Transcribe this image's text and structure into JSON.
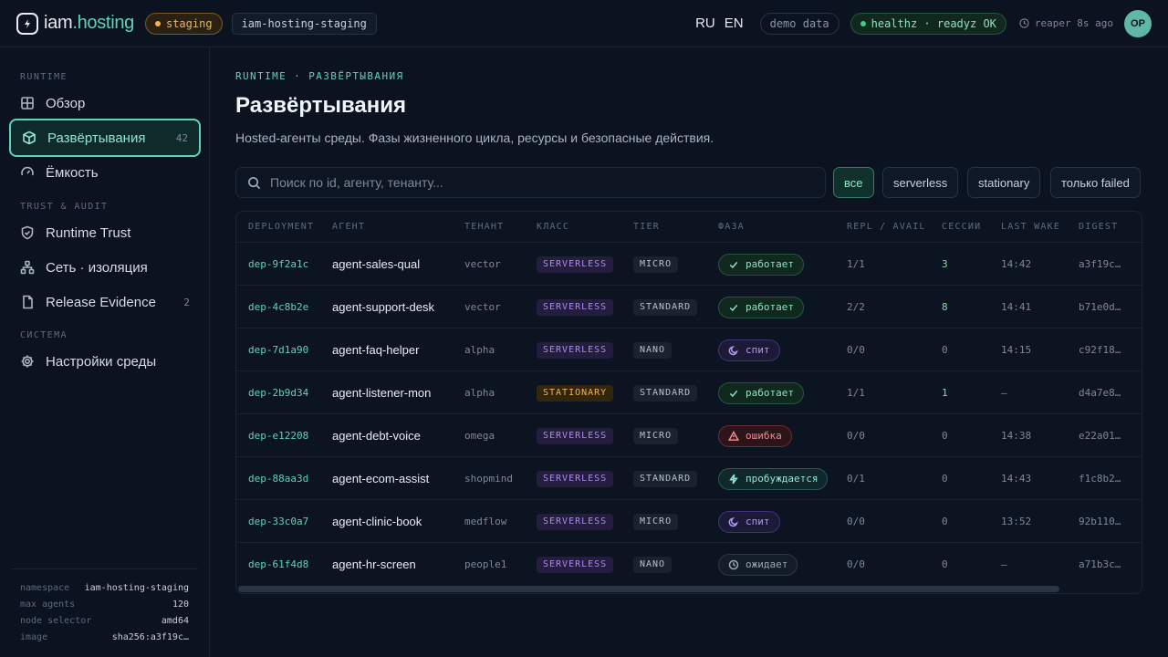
{
  "app": {
    "logo_left": "iam",
    "logo_right": ".hosting",
    "env_badge": "staging",
    "namespace_badge": "iam-hosting-staging",
    "lang_ru": "RU",
    "lang_en": "EN",
    "demo_badge": "demo data",
    "health_badge": "healthz · readyz OK",
    "reaper_text": "reaper 8s ago",
    "avatar_initials": "OP"
  },
  "sidebar": {
    "sections": [
      "RUNTIME",
      "TRUST & AUDIT",
      "СИСТЕМА"
    ],
    "items": [
      {
        "label": "Обзор",
        "icon": "grid-icon"
      },
      {
        "label": "Развёртывания",
        "icon": "cube-icon",
        "count": "42",
        "active": true
      },
      {
        "label": "Ёмкость",
        "icon": "gauge-icon"
      },
      {
        "label": "Runtime Trust",
        "icon": "shield-icon"
      },
      {
        "label": "Сеть · изоляция",
        "icon": "network-icon"
      },
      {
        "label": "Release Evidence",
        "icon": "file-icon",
        "count": "2"
      },
      {
        "label": "Настройки среды",
        "icon": "gear-icon"
      }
    ],
    "meta": [
      {
        "k": "namespace",
        "v": "iam-hosting-staging"
      },
      {
        "k": "max agents",
        "v": "120"
      },
      {
        "k": "node selector",
        "v": "amd64"
      },
      {
        "k": "image",
        "v": "sha256:a3f19c…"
      }
    ]
  },
  "main": {
    "breadcrumb": "RUNTIME · РАЗВЁРТЫВАНИЯ",
    "title": "Развёртывания",
    "subtitle": "Hosted-агенты среды. Фазы жизненного цикла, ресурсы и безопасные действия.",
    "search_placeholder": "Поиск по id, агенту, тенанту...",
    "filters": [
      "все",
      "serverless",
      "stationary",
      "только failed"
    ],
    "columns": [
      "DEPLOYMENT",
      "АГЕНТ",
      "ТЕНАНТ",
      "КЛАСС",
      "TIER",
      "ФАЗА",
      "REPL / AVAIL",
      "СЕССИИ",
      "LAST WAKE",
      "DIGEST"
    ],
    "rows": [
      {
        "id": "dep-9f2a1c",
        "agent": "agent-sales-qual",
        "tenant": "vector",
        "cls": "SERVERLESS",
        "tier": "MICRO",
        "phase": "работает",
        "phase_kind": "run",
        "repl": "1/1",
        "sess": "3",
        "wake": "14:42",
        "digest": "a3f19c…"
      },
      {
        "id": "dep-4c8b2e",
        "agent": "agent-support-desk",
        "tenant": "vector",
        "cls": "SERVERLESS",
        "tier": "STANDARD",
        "phase": "работает",
        "phase_kind": "run",
        "repl": "2/2",
        "sess": "8",
        "wake": "14:41",
        "digest": "b71e0d…"
      },
      {
        "id": "dep-7d1a90",
        "agent": "agent-faq-helper",
        "tenant": "alpha",
        "cls": "SERVERLESS",
        "tier": "NANO",
        "phase": "спит",
        "phase_kind": "sleep",
        "repl": "0/0",
        "sess": "0",
        "wake": "14:15",
        "digest": "c92f18…"
      },
      {
        "id": "dep-2b9d34",
        "agent": "agent-listener-mon",
        "tenant": "alpha",
        "cls": "STATIONARY",
        "tier": "STANDARD",
        "phase": "работает",
        "phase_kind": "run",
        "repl": "1/1",
        "sess": "1",
        "wake": "—",
        "digest": "d4a7e8…"
      },
      {
        "id": "dep-e12208",
        "agent": "agent-debt-voice",
        "tenant": "omega",
        "cls": "SERVERLESS",
        "tier": "MICRO",
        "phase": "ошибка",
        "phase_kind": "err",
        "repl": "0/0",
        "sess": "0",
        "wake": "14:38",
        "digest": "e22a01…"
      },
      {
        "id": "dep-88aa3d",
        "agent": "agent-ecom-assist",
        "tenant": "shopmind",
        "cls": "SERVERLESS",
        "tier": "STANDARD",
        "phase": "пробуждается",
        "phase_kind": "wake",
        "repl": "0/1",
        "sess": "0",
        "wake": "14:43",
        "digest": "f1c8b2…"
      },
      {
        "id": "dep-33c0a7",
        "agent": "agent-clinic-book",
        "tenant": "medflow",
        "cls": "SERVERLESS",
        "tier": "MICRO",
        "phase": "спит",
        "phase_kind": "sleep",
        "repl": "0/0",
        "sess": "0",
        "wake": "13:52",
        "digest": "92b110…"
      },
      {
        "id": "dep-61f4d8",
        "agent": "agent-hr-screen",
        "tenant": "people1",
        "cls": "SERVERLESS",
        "tier": "NANO",
        "phase": "ожидает",
        "phase_kind": "wait",
        "repl": "0/0",
        "sess": "0",
        "wake": "—",
        "digest": "a71b3c…"
      }
    ]
  }
}
